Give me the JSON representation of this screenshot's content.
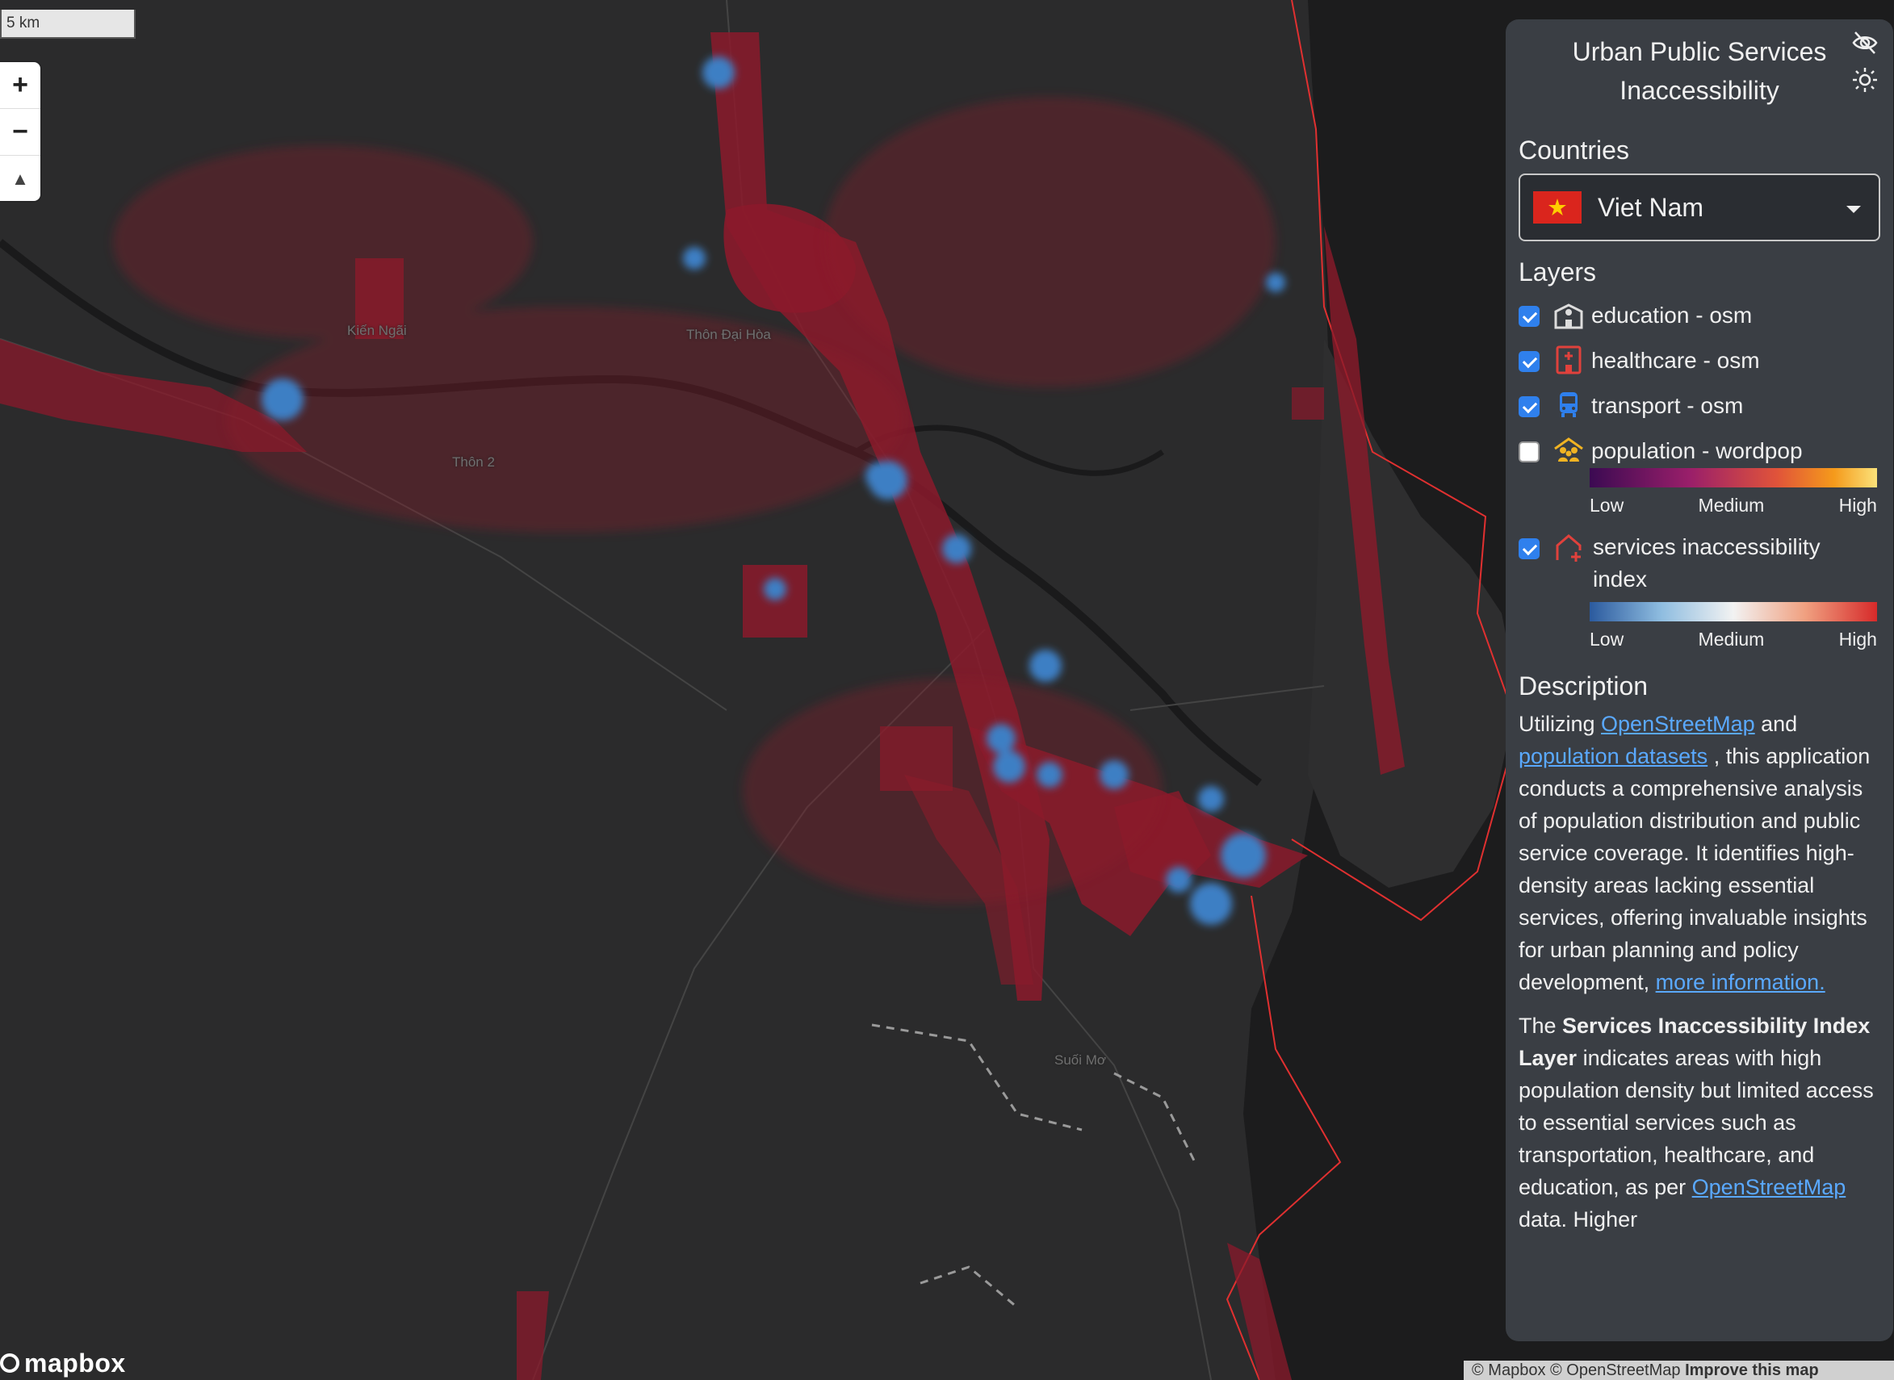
{
  "map": {
    "scale_label": "5 km",
    "place_labels": [
      "Kiến Ngãi",
      "Thôn Đại Hòa",
      "Thôn 2",
      "Suối Mơ"
    ],
    "colors": {
      "background": "#2b2b2c",
      "inaccessible": "#8b1a2b",
      "accessible": "#3d7fc4",
      "coastline": "#e03030"
    },
    "logo_text": "mapbox",
    "attribution_prefix": "© Mapbox © OpenStreetMap",
    "attribution_link": "Improve this map"
  },
  "zoom": {
    "in": "+",
    "out": "−",
    "compass": "▲"
  },
  "panel": {
    "title": "Urban Public Services Inaccessibility",
    "countries_label": "Countries",
    "selected_country": "Viet Nam",
    "layers_label": "Layers",
    "layers": [
      {
        "label": "education - osm",
        "checked": true,
        "icon": "school-icon"
      },
      {
        "label": "healthcare - osm",
        "checked": true,
        "icon": "hospital-icon"
      },
      {
        "label": "transport - osm",
        "checked": true,
        "icon": "bus-icon"
      },
      {
        "label": "population - wordpop",
        "checked": false,
        "icon": "people-roof-icon"
      },
      {
        "label": "services inaccessibility index",
        "checked": true,
        "icon": "house-plus-icon"
      }
    ],
    "population_legend": {
      "low": "Low",
      "medium": "Medium",
      "high": "High"
    },
    "index_legend": {
      "low": "Low",
      "medium": "Medium",
      "high": "High"
    },
    "description_label": "Description",
    "desc1_pre": "Utilizing ",
    "desc1_link1": "OpenStreetMap",
    "desc1_mid": " and ",
    "desc1_link2": "population datasets",
    "desc1_post": " , this application conducts a comprehensive analysis of population distribution and public service coverage. It identifies high-density areas lacking essential services, offering invaluable insights for urban planning and policy development, ",
    "desc1_link3": "more information.",
    "desc2_pre": "The ",
    "desc2_bold": "Services Inaccessibility Index Layer",
    "desc2_post": " indicates areas with high population density but limited access to essential services such as transportation, healthcare, and education, as per ",
    "desc2_link": "OpenStreetMap",
    "desc2_tail": " data. Higher"
  }
}
